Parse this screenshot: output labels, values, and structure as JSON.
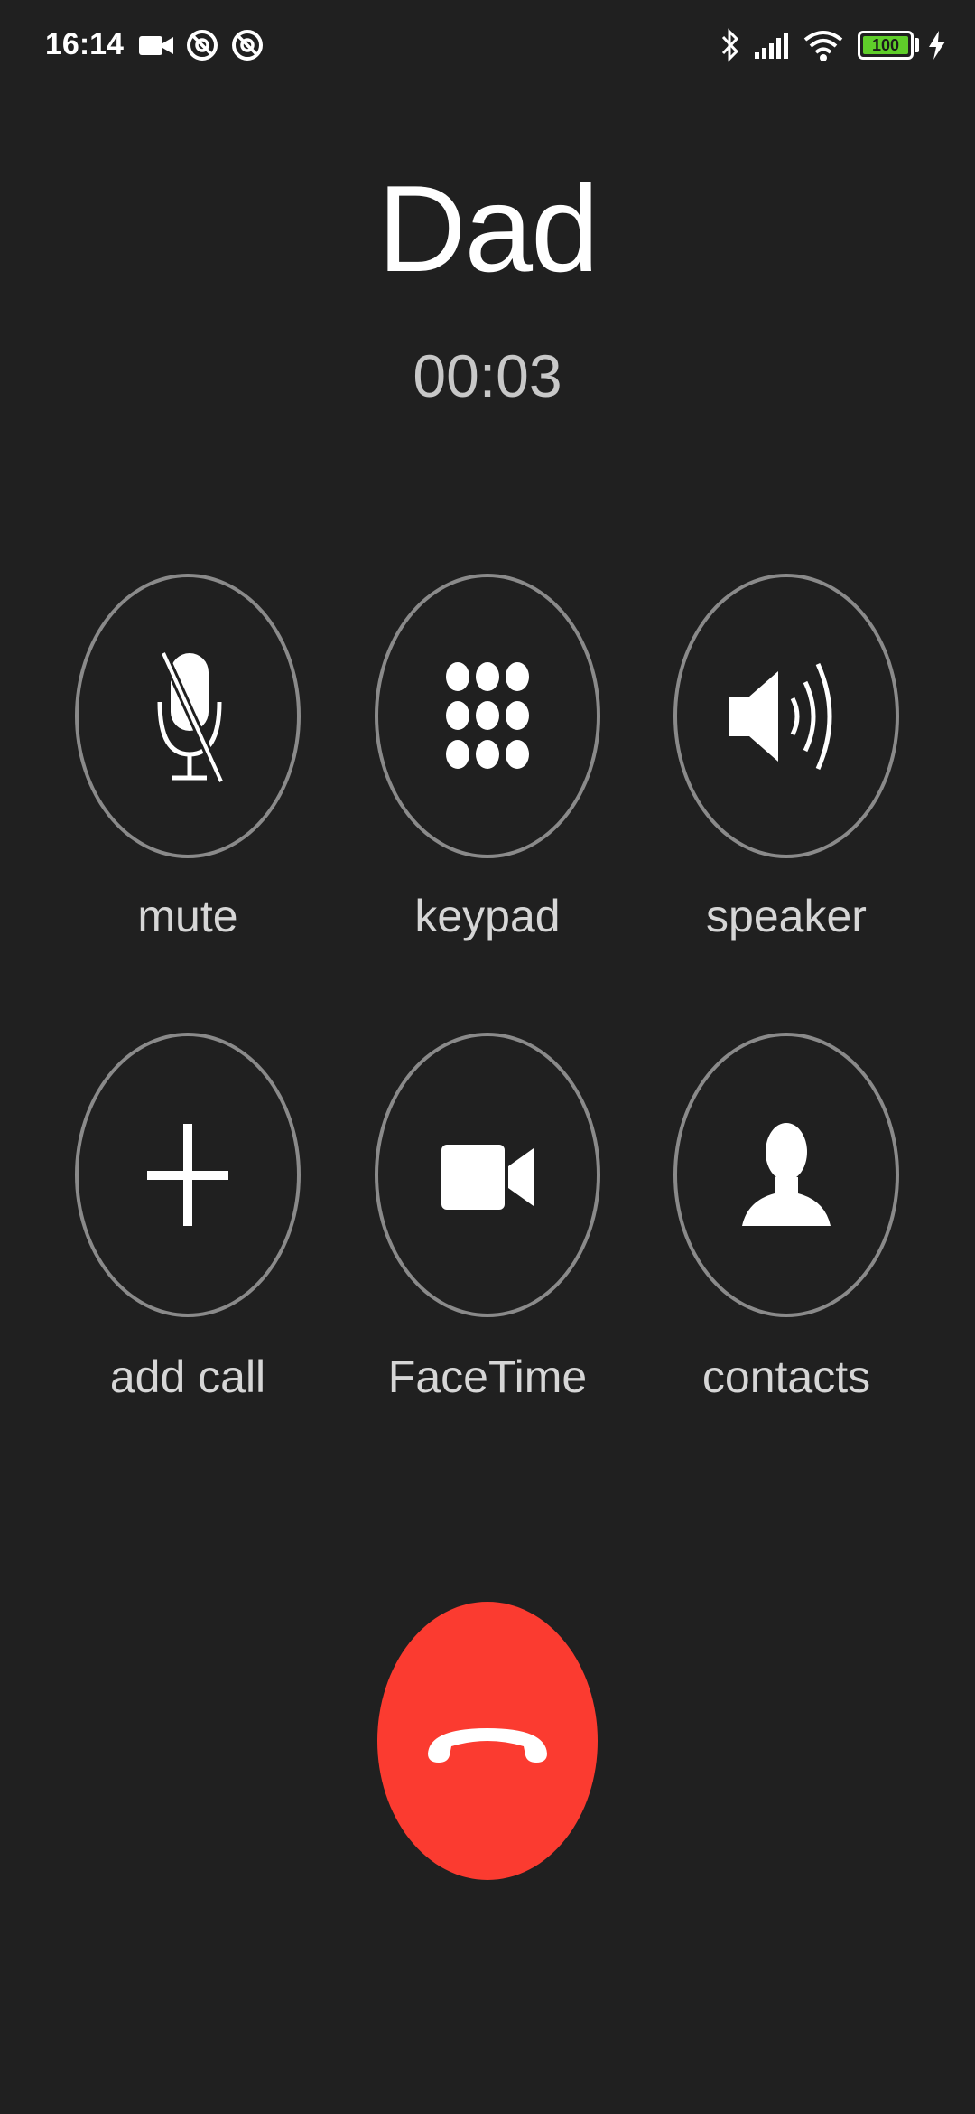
{
  "status_bar": {
    "time": "16:14",
    "battery_percent": "100",
    "icons": [
      "video-camera-icon",
      "notification-icon",
      "notification-icon",
      "bluetooth-icon",
      "cellular-signal-icon",
      "wifi-icon",
      "battery-icon",
      "charging-icon"
    ]
  },
  "call": {
    "caller_name": "Dad",
    "duration": "00:03"
  },
  "controls": {
    "mute_label": "mute",
    "keypad_label": "keypad",
    "speaker_label": "speaker",
    "add_call_label": "add call",
    "facetime_label": "FaceTime",
    "contacts_label": "contacts"
  },
  "colors": {
    "background": "#202020",
    "end_call": "#fb3b30",
    "ring": "#8a8a8a",
    "battery": "#5fce2a"
  }
}
